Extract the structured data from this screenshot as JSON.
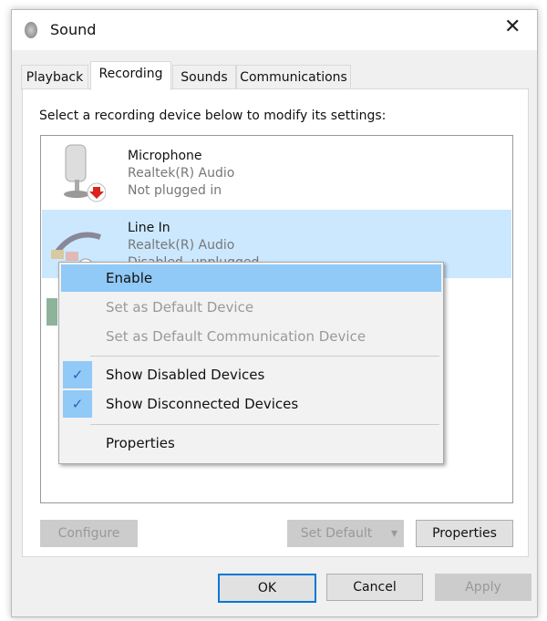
{
  "window": {
    "title": "Sound",
    "close": "✕"
  },
  "tabs": [
    {
      "label": "Playback"
    },
    {
      "label": "Recording",
      "active": true
    },
    {
      "label": "Sounds"
    },
    {
      "label": "Communications"
    }
  ],
  "instruction": "Select a recording device below to modify its settings:",
  "devices": [
    {
      "name": "Microphone",
      "driver": "Realtek(R) Audio",
      "status": "Not plugged in",
      "icon": "microphone-icon"
    },
    {
      "name": "Line In",
      "driver": "Realtek(R) Audio",
      "status": "Disabled, unplugged",
      "icon": "line-in-icon",
      "selected": true
    }
  ],
  "context_menu": [
    {
      "label": "Enable",
      "highlighted": true
    },
    {
      "label": "Set as Default Device",
      "disabled": true
    },
    {
      "label": "Set as Default Communication Device",
      "disabled": true
    },
    {
      "label": "Show Disabled Devices",
      "checked": true
    },
    {
      "label": "Show Disconnected Devices",
      "checked": true
    },
    {
      "label": "Properties"
    }
  ],
  "check_glyph": "✓",
  "buttons": {
    "configure": "Configure",
    "set_default": "Set Default",
    "properties": "Properties",
    "ok": "OK",
    "cancel": "Cancel",
    "apply": "Apply"
  },
  "colors": {
    "selection": "#cce8ff",
    "menu_highlight": "#91c9f7",
    "unplugged_badge": "#d9251d"
  }
}
